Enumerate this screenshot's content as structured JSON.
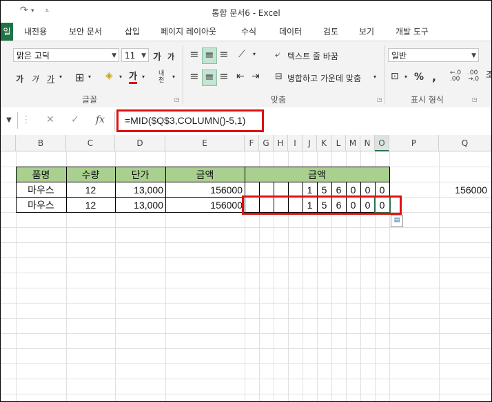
{
  "window": {
    "title": "통합 문서6 - Excel"
  },
  "quick_access": {
    "redo_icon": "redo-icon",
    "customize_icon": "customize-icon"
  },
  "tabs": {
    "file": "일",
    "items": [
      "내전용",
      "보안 문서",
      "삽입",
      "페이지 레이아웃",
      "수식",
      "데이터",
      "검토",
      "보기",
      "개발 도구"
    ]
  },
  "ribbon": {
    "font_name": "맑은 고딕",
    "font_size": "11",
    "grow_font": "가",
    "shrink_font": "가",
    "bold": "가",
    "italic": "가",
    "underline": "가",
    "font_color_letter": "가",
    "phonetic": "내천",
    "wrap_text": "텍스트 줄 바꿈",
    "merge_center": "병합하고 가운데 맞춤",
    "number_format": "일반",
    "percent": "%",
    "comma": ",",
    "font_group": "글꼴",
    "align_group": "맞춤",
    "number_group": "표시 형식",
    "right_edge_label": "조"
  },
  "formula_bar": {
    "formula": "=MID($Q$3,COLUMN()-5,1)",
    "cancel": "✕",
    "enter": "✓",
    "fx": "fx"
  },
  "columns": [
    "B",
    "C",
    "D",
    "E",
    "F",
    "G",
    "H",
    "I",
    "J",
    "K",
    "L",
    "M",
    "N",
    "O",
    "P",
    "Q"
  ],
  "table": {
    "headers": {
      "name": "품명",
      "qty": "수량",
      "price": "단가",
      "amount": "금액",
      "amount_digits": "금액"
    },
    "rows": [
      {
        "name": "마우스",
        "qty": "12",
        "price": "13,000",
        "amount": "156000",
        "digits": [
          "",
          "",
          "",
          "",
          "1",
          "5",
          "6",
          "0",
          "0",
          "0"
        ]
      },
      {
        "name": "마우스",
        "qty": "12",
        "price": "13,000",
        "amount": "156000",
        "digits": [
          "",
          "",
          "",
          "",
          "1",
          "5",
          "6",
          "0",
          "0",
          "0"
        ]
      }
    ],
    "q_value": "156000"
  }
}
